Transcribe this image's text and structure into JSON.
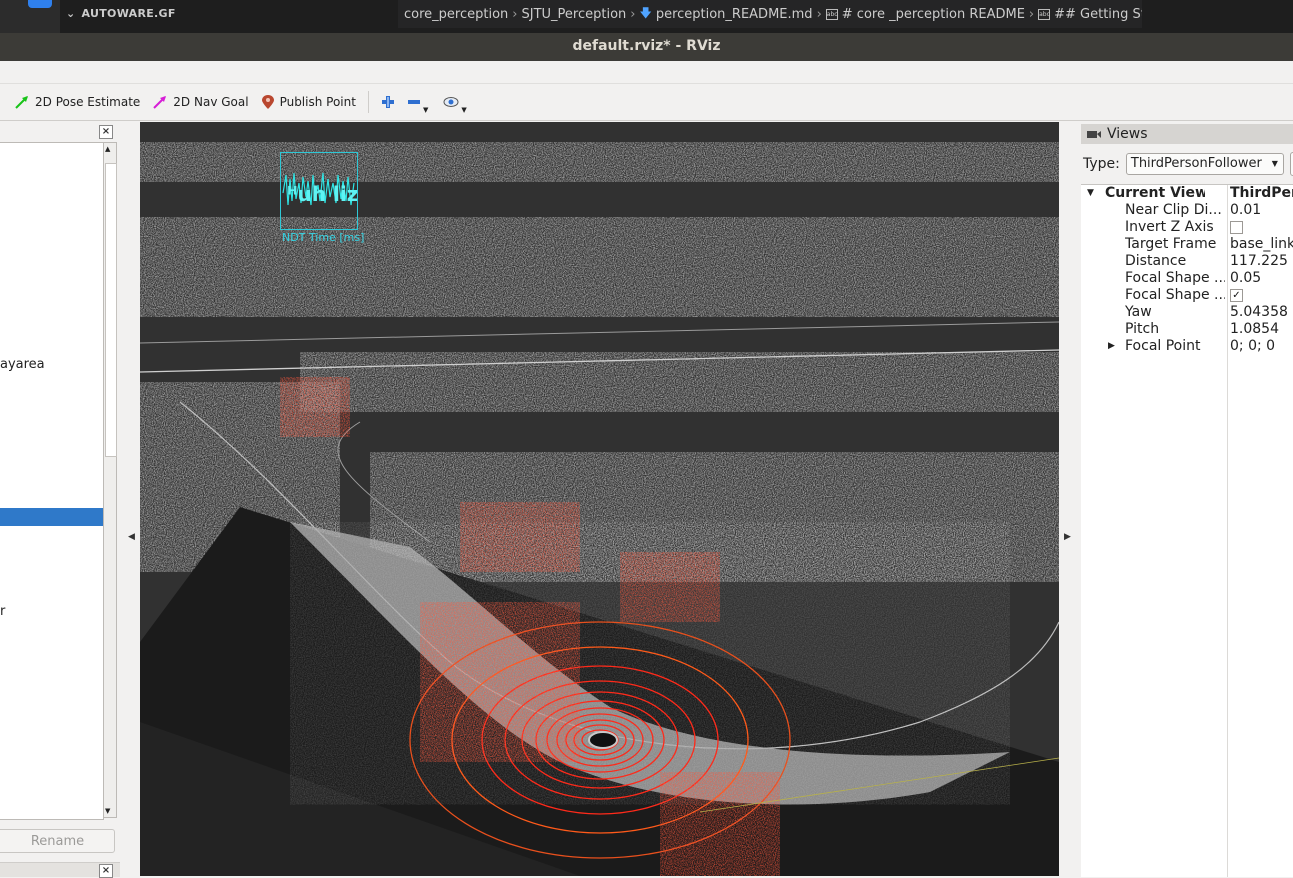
{
  "vscode": {
    "explorer_title": "AUTOWARE.GF",
    "breadcrumbs": [
      "core_perception",
      "SJTU_Perception",
      "perception_README.md",
      "# core _perception README",
      "## Getting Start"
    ]
  },
  "window": {
    "title": "default.rviz* - RViz"
  },
  "toolbar": {
    "pose_estimate": "2D Pose Estimate",
    "nav_goal": "2D Nav Goal",
    "publish_point": "Publish Point",
    "colors": {
      "pose": "#19c319",
      "nav": "#d61fd6",
      "point": "#c0392b",
      "tool_icon": "#2f6fd0"
    }
  },
  "displays": {
    "rows": [
      {
        "text": "ayarea"
      },
      {
        "text": ""
      },
      {
        "text": "r"
      }
    ],
    "rename_label": "Rename"
  },
  "viewport": {
    "overlay_label": "NDT Time [ms]",
    "overlay_text": "ᴴuh lizb"
  },
  "views": {
    "header": "Views",
    "type_label": "Type:",
    "type_value": "ThirdPersonFollower",
    "properties": [
      {
        "name": "Current View",
        "value": "ThirdPers",
        "bold": true
      },
      {
        "name": "Near Clip Di...",
        "value": "0.01"
      },
      {
        "name": "Invert Z Axis",
        "value": "",
        "checkbox": "unchecked"
      },
      {
        "name": "Target Frame",
        "value": "base_link"
      },
      {
        "name": "Distance",
        "value": "117.225"
      },
      {
        "name": "Focal Shape ...",
        "value": "0.05"
      },
      {
        "name": "Focal Shape ...",
        "value": "",
        "checkbox": "checked"
      },
      {
        "name": "Yaw",
        "value": "5.04358"
      },
      {
        "name": "Pitch",
        "value": "1.0854"
      },
      {
        "name": "Focal Point",
        "value": "0; 0; 0",
        "expandable": true
      }
    ]
  }
}
